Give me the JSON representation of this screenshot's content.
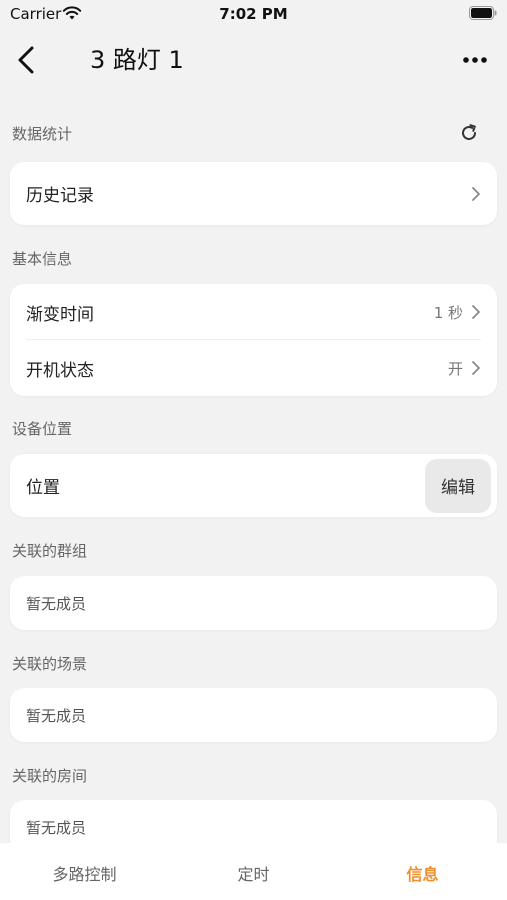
{
  "status_bar": {
    "carrier": "Carrier",
    "time": "7:02 PM"
  },
  "nav": {
    "title": "3 路灯 1"
  },
  "sections": {
    "stats": {
      "label": "数据统计"
    },
    "basic": {
      "label": "基本信息"
    },
    "location": {
      "label": "设备位置"
    },
    "groups": {
      "label": "关联的群组"
    },
    "scenes": {
      "label": "关联的场景"
    },
    "rooms": {
      "label": "关联的房间"
    }
  },
  "rows": {
    "history": {
      "label": "历史记录"
    },
    "fade_time": {
      "label": "渐变时间",
      "value": "1 秒"
    },
    "power_on_state": {
      "label": "开机状态",
      "value": "开"
    },
    "location": {
      "label": "位置",
      "edit_label": "编辑"
    },
    "groups_empty": "暂无成员",
    "scenes_empty": "暂无成员",
    "rooms_empty": "暂无成员"
  },
  "tabs": [
    {
      "label": "多路控制",
      "active": false
    },
    {
      "label": "定时",
      "active": false
    },
    {
      "label": "信息",
      "active": true
    }
  ],
  "colors": {
    "accent": "#f0902b",
    "background": "#f2f2f2",
    "card": "#ffffff"
  }
}
